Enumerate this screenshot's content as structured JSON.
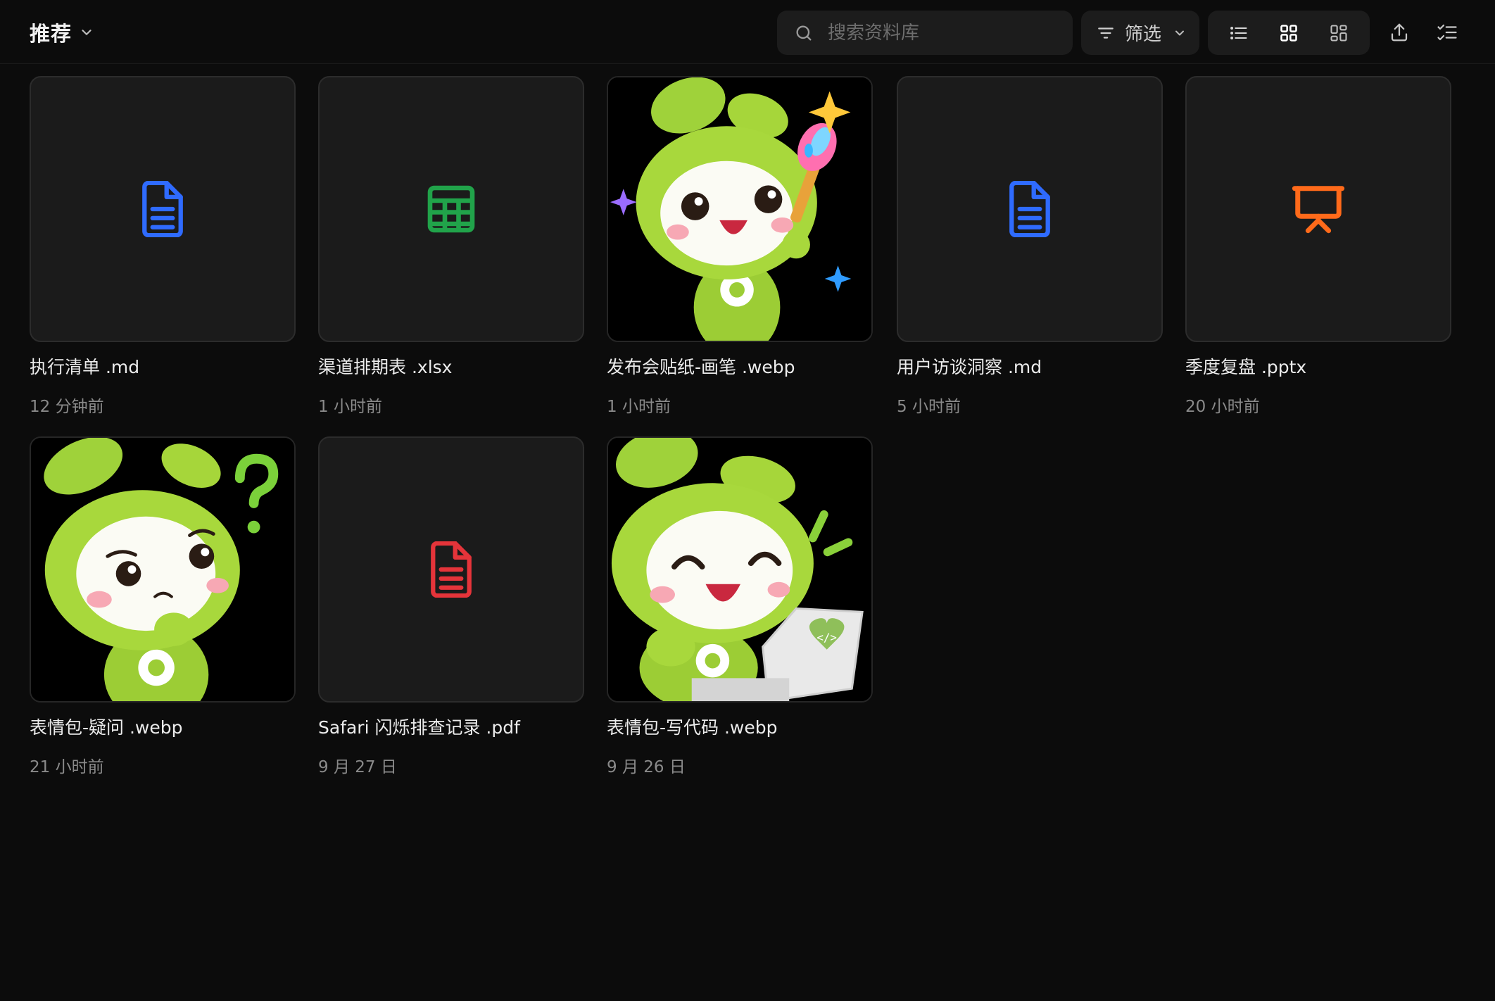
{
  "header": {
    "title": "推荐",
    "search_placeholder": "搜索资料库",
    "filter_label": "筛选"
  },
  "colors": {
    "doc_blue": "#2f6bff",
    "sheet_green": "#21a34a",
    "pdf_red": "#e5343a",
    "ppt_orange": "#ff6a1a",
    "mascot_green": "#a6d63a"
  },
  "files": [
    {
      "name": "执行清单 .md",
      "time": "12 分钟前",
      "kind": "document",
      "icon": "document-icon"
    },
    {
      "name": "渠道排期表 .xlsx",
      "time": "1 小时前",
      "kind": "spreadsheet",
      "icon": "spreadsheet-icon"
    },
    {
      "name": "发布会贴纸-画笔 .webp",
      "time": "1 小时前",
      "kind": "image",
      "icon": "mascot-paintbrush-image"
    },
    {
      "name": "用户访谈洞察 .md",
      "time": "5 小时前",
      "kind": "document",
      "icon": "document-icon"
    },
    {
      "name": "季度复盘 .pptx",
      "time": "20 小时前",
      "kind": "presentation",
      "icon": "presentation-icon"
    },
    {
      "name": "表情包-疑问 .webp",
      "time": "21 小时前",
      "kind": "image",
      "icon": "mascot-question-image"
    },
    {
      "name": "Safari 闪烁排查记录 .pdf",
      "time": "9 月 27 日",
      "kind": "pdf",
      "icon": "pdf-document-icon"
    },
    {
      "name": "表情包-写代码 .webp",
      "time": "9 月 26 日",
      "kind": "image",
      "icon": "mascot-laptop-image"
    }
  ]
}
